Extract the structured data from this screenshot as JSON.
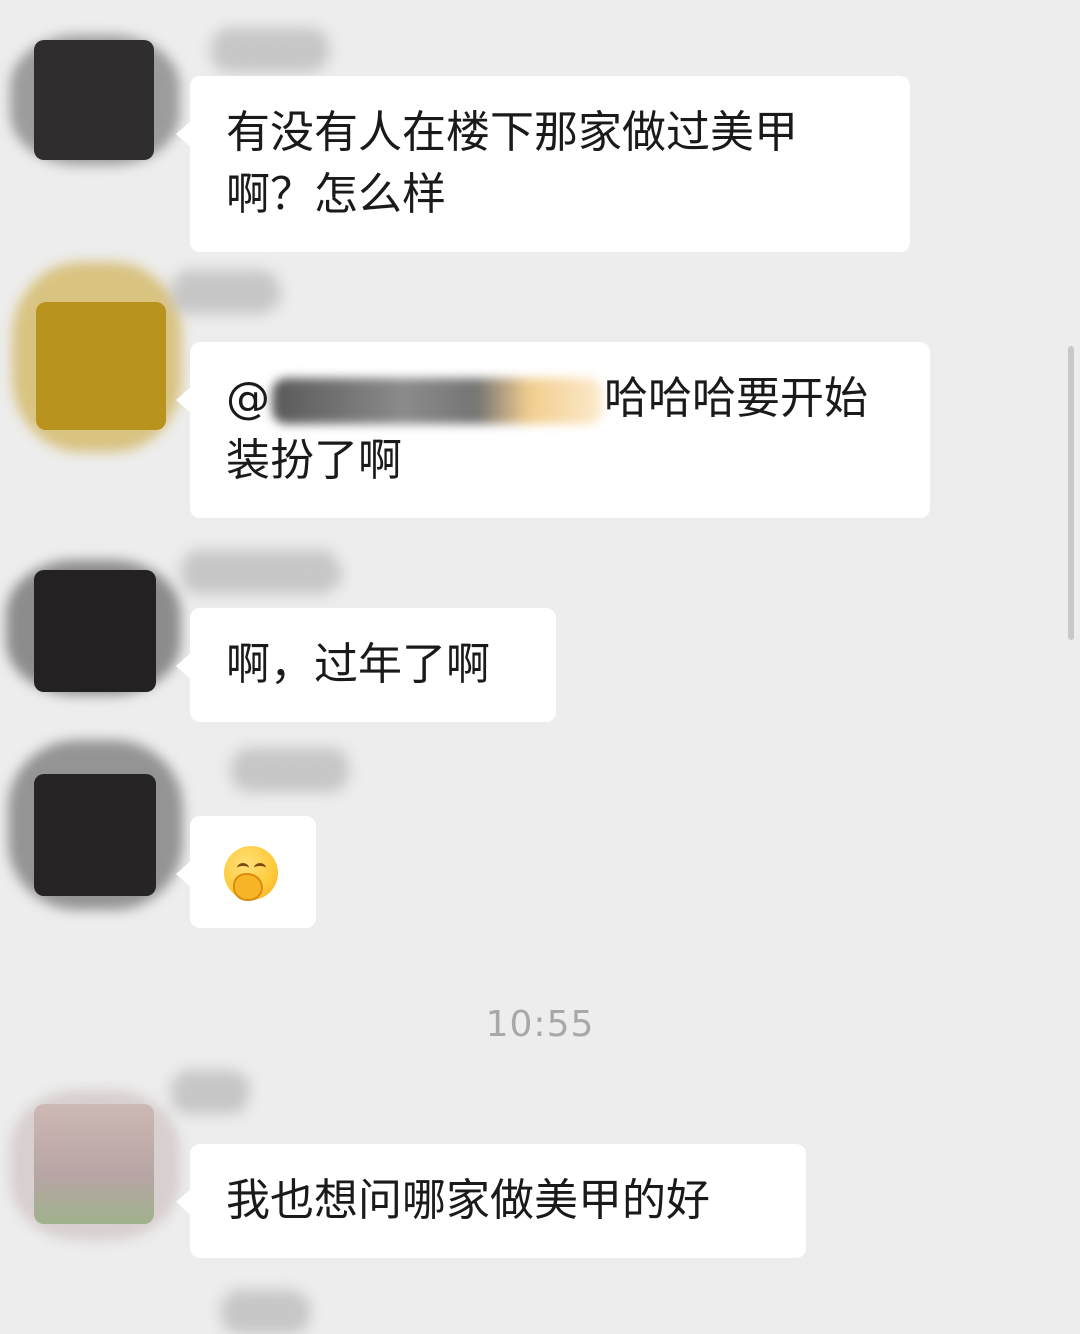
{
  "chat": {
    "messages": [
      {
        "lines": [
          "有没有人在楼下那家做过美甲",
          "啊？怎么样"
        ]
      },
      {
        "mention_prefix": "@",
        "mention_suffix": "哈哈哈要开始",
        "second_line": "装扮了啊"
      },
      {
        "lines": [
          "啊，过年了啊"
        ]
      },
      {
        "emoji": "covering-mouth-smile-emoji"
      },
      {
        "lines": [
          "我也想问哪家做美甲的好"
        ]
      }
    ],
    "timestamp": "10:55"
  },
  "colors": {
    "background": "#ededed",
    "bubble": "#ffffff",
    "text": "#1a1a1a",
    "timestamp": "#a8a8a8"
  }
}
